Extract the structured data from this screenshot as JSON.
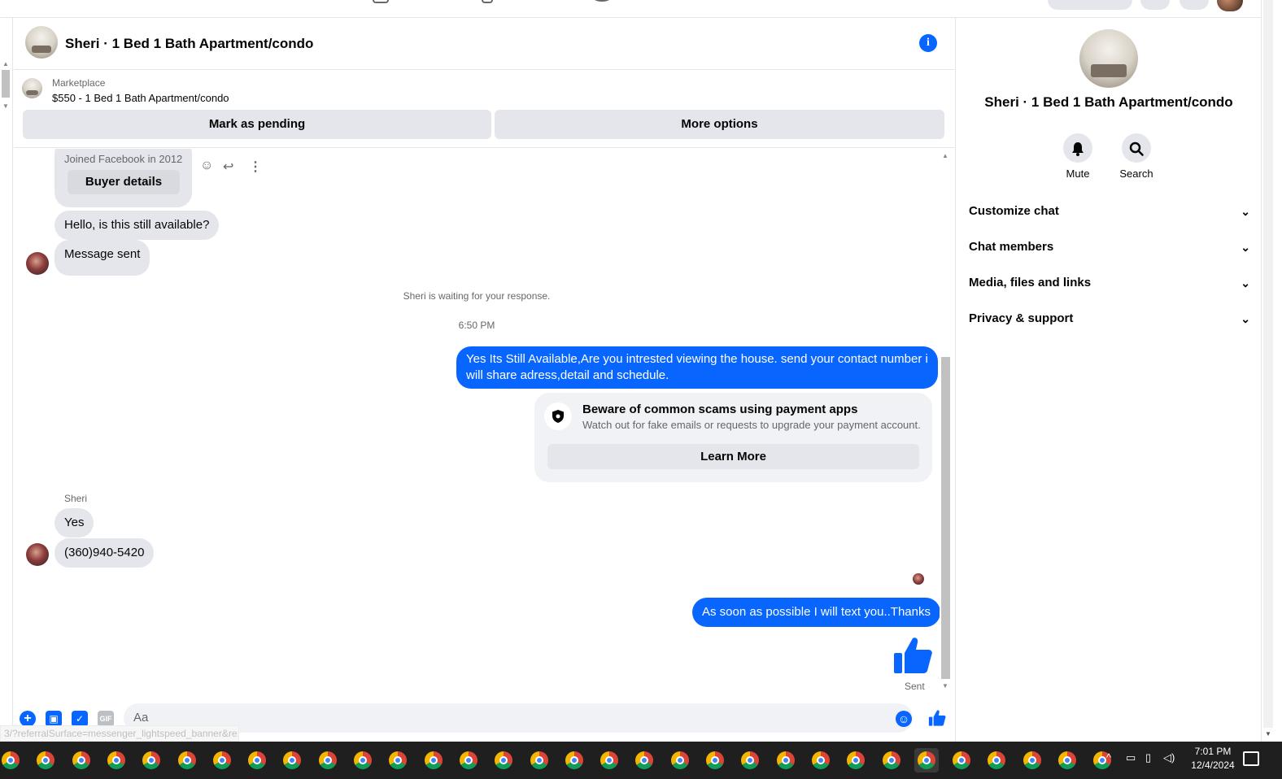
{
  "header": {
    "title": "Sheri · 1 Bed 1 Bath Apartment/condo"
  },
  "marketplace": {
    "label": "Marketplace",
    "item": "$550 - 1 Bed 1 Bath Apartment/condo",
    "mark_pending": "Mark as pending",
    "more_options": "More options"
  },
  "messages": {
    "joined": "Joined Facebook in 2012",
    "buyer_details": "Buyer details",
    "msg1": "Hello, is this still available?",
    "msg2": "Message sent",
    "waiting": "Sheri is waiting for your response.",
    "time": "6:50 PM",
    "out1_line1": "Yes Its Still Available,Are you intrested viewing the house. send your contact number i",
    "out1_line2": "will share adress,detail and schedule.",
    "warning_title": "Beware of common scams using payment apps",
    "warning_text": "Watch out for fake emails or requests to upgrade your payment account.",
    "learn_more": "Learn More",
    "sender_name": "Sheri",
    "in_yes": "Yes",
    "in_phone": "(360)940-5420",
    "out2": "As soon as possible I will text you..Thanks",
    "sent_status": "Sent"
  },
  "composer": {
    "placeholder": "Aa",
    "gif_label": "GIF"
  },
  "status_url": "3/?referralSurface=messenger_lightspeed_banner&re...",
  "right_panel": {
    "title": "Sheri · 1 Bed 1 Bath Apartment/condo",
    "mute": "Mute",
    "search": "Search",
    "sections": [
      "Customize chat",
      "Chat members",
      "Media, files and links",
      "Privacy & support"
    ]
  },
  "taskbar": {
    "time": "7:01 PM",
    "date": "12/4/2024",
    "app_count": 32,
    "active_app_index": 26
  },
  "icons": {
    "info": "info-icon",
    "bell": "bell-icon",
    "search": "search-icon",
    "chevron": "chevron-down-icon",
    "shield": "shield-icon",
    "like": "thumbs-up-icon",
    "plus": "plus-icon",
    "image": "image-icon",
    "sticker": "sticker-icon",
    "emoji": "emoji-icon",
    "chrome": "chrome-icon"
  },
  "colors": {
    "accent": "#0866ff",
    "bubble_in": "#e4e6eb",
    "taskbar": "#1f1f1f"
  }
}
